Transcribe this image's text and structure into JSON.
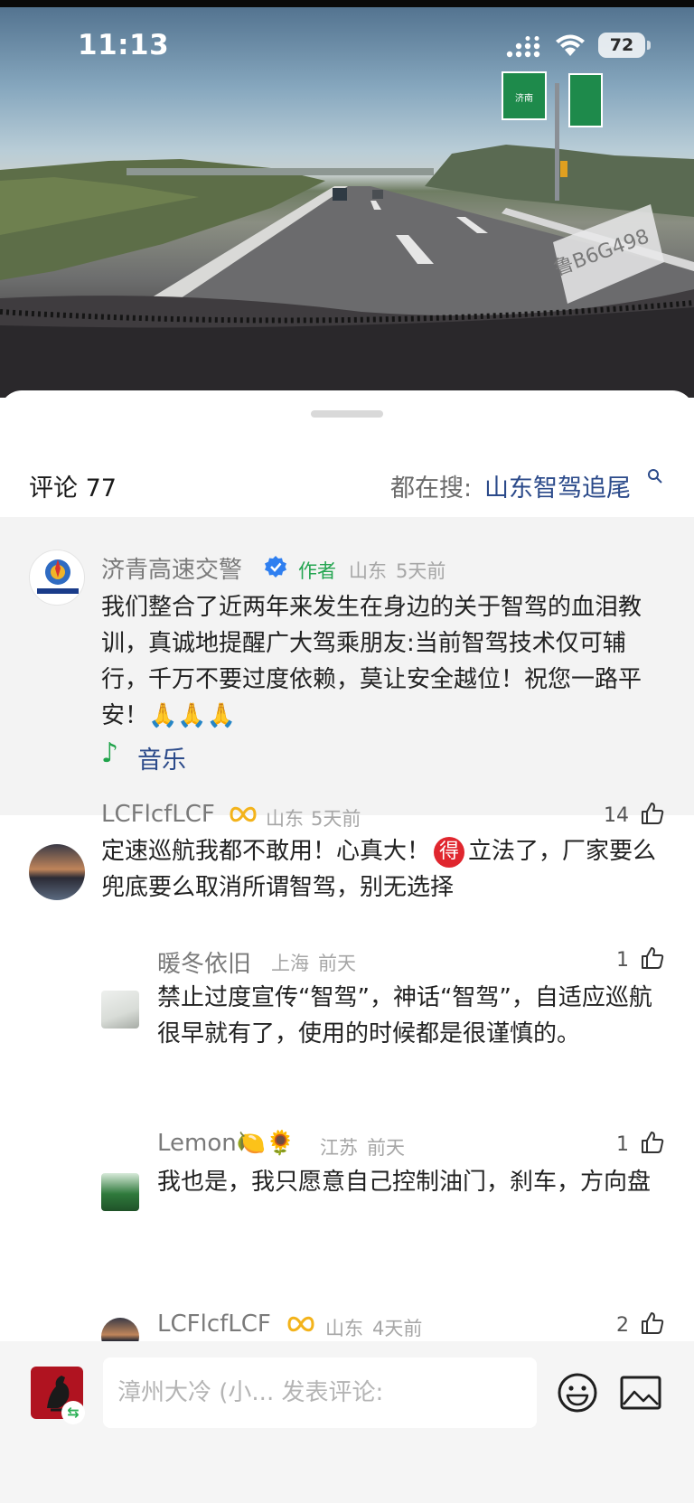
{
  "status_bar": {
    "time": "11:13",
    "battery": "72"
  },
  "video": {
    "sign_text_1": "济南",
    "plate_text": "鲁B6G498"
  },
  "header": {
    "comment_label": "评论 77",
    "search_prefix": "都在搜:",
    "search_term": "山东智驾追尾"
  },
  "pinned": {
    "name": "济青高速交警",
    "author_tag": "作者",
    "location": "山东",
    "time": "5天前",
    "text": "我们整合了近两年来发生在身边的关于智驾的血泪教训，真诚地提醒广大驾乘朋友:当前智驾技术仅可辅行，千万不要过度依赖，莫让安全越位！祝您一路平安！🙏🙏🙏",
    "music_label": "音乐",
    "logo_text": "济青高速交警"
  },
  "comments": [
    {
      "name": "LCFlcfLCF",
      "location": "山东",
      "time": "5天前",
      "likes": "14",
      "text_a": "定速巡航我都不敢用！心真大！",
      "badge": "得",
      "text_b": "立法了，厂家要么兜底要么取消所谓智驾，别无选择"
    }
  ],
  "replies": [
    {
      "name": "暖冬依旧",
      "location": "上海",
      "time": "前天",
      "likes": "1",
      "text": "禁止过度宣传“智驾”，神话“智驾”，自适应巡航很早就有了，使用的时候都是很谨慎的。"
    },
    {
      "name": "Lemon🍋🌻",
      "location": "江苏",
      "time": "前天",
      "likes": "1",
      "text": "我也是，我只愿意自己控制油门，刹车，方向盘"
    },
    {
      "name": "LCFlcfLCF",
      "location": "山东",
      "time": "4天前",
      "likes": "2"
    }
  ],
  "composer": {
    "placeholder": "漳州大冷 (小... 发表评论:"
  },
  "colors": {
    "link_blue": "#2b4a8a",
    "author_green": "#24a551",
    "pinned_bg": "#f3f3f3"
  }
}
